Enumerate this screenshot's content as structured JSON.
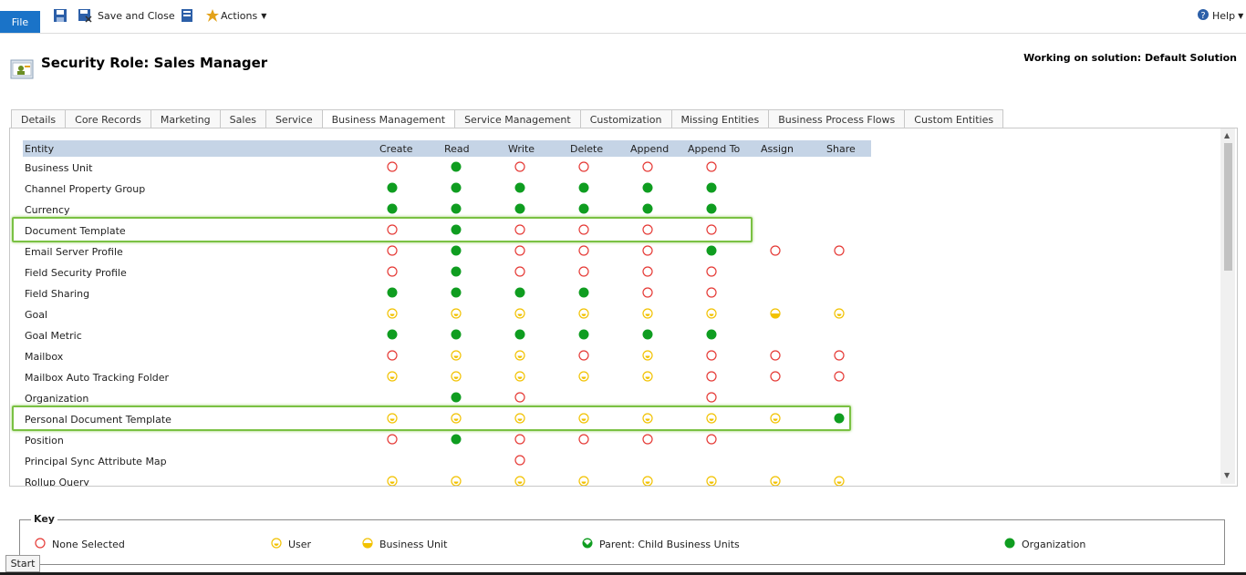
{
  "ribbon": {
    "file_label": "File",
    "save_close_label": "Save and Close",
    "actions_label": "Actions",
    "help_label": "Help"
  },
  "header": {
    "title": "Security Role: Sales Manager",
    "solution": "Working on solution: Default Solution"
  },
  "tabs": [
    "Details",
    "Core Records",
    "Marketing",
    "Sales",
    "Service",
    "Business Management",
    "Service Management",
    "Customization",
    "Missing Entities",
    "Business Process Flows",
    "Custom Entities"
  ],
  "active_tab": "Business Management",
  "columns": [
    "Entity",
    "Create",
    "Read",
    "Write",
    "Delete",
    "Append",
    "Append To",
    "Assign",
    "Share"
  ],
  "rows": [
    {
      "entity": "Business Unit",
      "levels": [
        "none",
        "org",
        "none",
        "none",
        "none",
        "none",
        "",
        ""
      ]
    },
    {
      "entity": "Channel Property Group",
      "levels": [
        "org",
        "org",
        "org",
        "org",
        "org",
        "org",
        "",
        ""
      ]
    },
    {
      "entity": "Currency",
      "levels": [
        "org",
        "org",
        "org",
        "org",
        "org",
        "org",
        "",
        ""
      ]
    },
    {
      "entity": "Document Template",
      "levels": [
        "none",
        "org",
        "none",
        "none",
        "none",
        "none",
        "",
        ""
      ],
      "highlighted": true
    },
    {
      "entity": "Email Server Profile",
      "levels": [
        "none",
        "org",
        "none",
        "none",
        "none",
        "org",
        "none",
        "none"
      ]
    },
    {
      "entity": "Field Security Profile",
      "levels": [
        "none",
        "org",
        "none",
        "none",
        "none",
        "none",
        "",
        ""
      ]
    },
    {
      "entity": "Field Sharing",
      "levels": [
        "org",
        "org",
        "org",
        "org",
        "none",
        "none",
        "",
        ""
      ]
    },
    {
      "entity": "Goal",
      "levels": [
        "user",
        "user",
        "user",
        "user",
        "user",
        "user",
        "bu",
        "user"
      ]
    },
    {
      "entity": "Goal Metric",
      "levels": [
        "org",
        "org",
        "org",
        "org",
        "org",
        "org",
        "",
        ""
      ]
    },
    {
      "entity": "Mailbox",
      "levels": [
        "none",
        "user",
        "user",
        "none",
        "user",
        "none",
        "none",
        "none"
      ]
    },
    {
      "entity": "Mailbox Auto Tracking Folder",
      "levels": [
        "user",
        "user",
        "user",
        "user",
        "user",
        "none",
        "none",
        "none"
      ]
    },
    {
      "entity": "Organization",
      "levels": [
        "",
        "org",
        "none",
        "",
        "",
        "none",
        "",
        ""
      ]
    },
    {
      "entity": "Personal Document Template",
      "levels": [
        "user",
        "user",
        "user",
        "user",
        "user",
        "user",
        "user",
        "org"
      ],
      "highlighted": true
    },
    {
      "entity": "Position",
      "levels": [
        "none",
        "org",
        "none",
        "none",
        "none",
        "none",
        "",
        ""
      ]
    },
    {
      "entity": "Principal Sync Attribute Map",
      "levels": [
        "",
        "",
        "none",
        "",
        "",
        "",
        "",
        ""
      ]
    },
    {
      "entity": "Rollup Query",
      "levels": [
        "user",
        "user",
        "user",
        "user",
        "user",
        "user",
        "user",
        "user"
      ]
    }
  ],
  "key": {
    "title": "Key",
    "items": [
      {
        "level": "none",
        "label": "None Selected"
      },
      {
        "level": "user",
        "label": "User"
      },
      {
        "level": "bu",
        "label": "Business Unit"
      },
      {
        "level": "parent",
        "label": "Parent: Child Business Units"
      },
      {
        "level": "org",
        "label": "Organization"
      }
    ]
  },
  "colors": {
    "none": "#e53935",
    "user": "#f2c200",
    "org": "#0f9d20",
    "highlight": "#7ac143",
    "file_button": "#1a73c8",
    "table_header": "#c5d4e6"
  },
  "start_label": "Start"
}
